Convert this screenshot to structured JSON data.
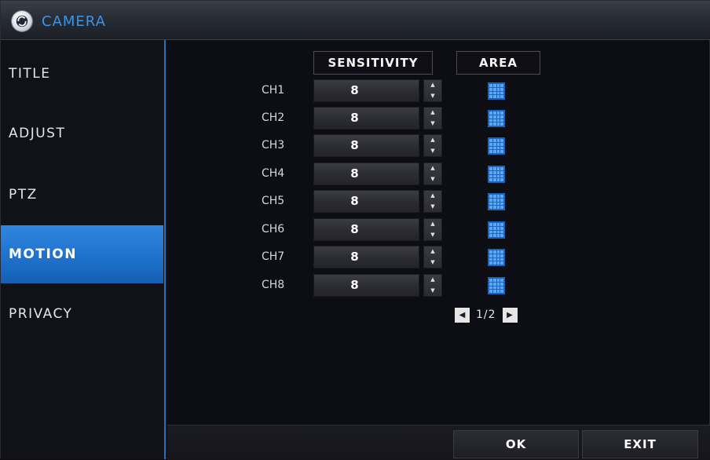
{
  "window": {
    "title": "CAMERA",
    "logo_icon": "camera-logo-icon"
  },
  "sidebar": {
    "items": [
      {
        "label": "TITLE",
        "active": false
      },
      {
        "label": "ADJUST",
        "active": false
      },
      {
        "label": "PTZ",
        "active": false
      },
      {
        "label": "MOTION",
        "active": true
      },
      {
        "label": "PRIVACY",
        "active": false
      }
    ]
  },
  "motion": {
    "headers": {
      "sensitivity": "SENSITIVITY",
      "area": "AREA"
    },
    "channels": [
      {
        "label": "CH1",
        "sensitivity": "8"
      },
      {
        "label": "CH2",
        "sensitivity": "8"
      },
      {
        "label": "CH3",
        "sensitivity": "8"
      },
      {
        "label": "CH4",
        "sensitivity": "8"
      },
      {
        "label": "CH5",
        "sensitivity": "8"
      },
      {
        "label": "CH6",
        "sensitivity": "8"
      },
      {
        "label": "CH7",
        "sensitivity": "8"
      },
      {
        "label": "CH8",
        "sensitivity": "8"
      }
    ],
    "area_icon": "grid-icon",
    "pager": {
      "text": "1/2",
      "prev_icon": "triangle-left-icon",
      "next_icon": "triangle-right-icon"
    }
  },
  "footer": {
    "ok_label": "OK",
    "exit_label": "EXIT"
  },
  "colors": {
    "accent": "#2073c1",
    "title_text": "#3d95e6",
    "active_item": "#1f72cc"
  }
}
